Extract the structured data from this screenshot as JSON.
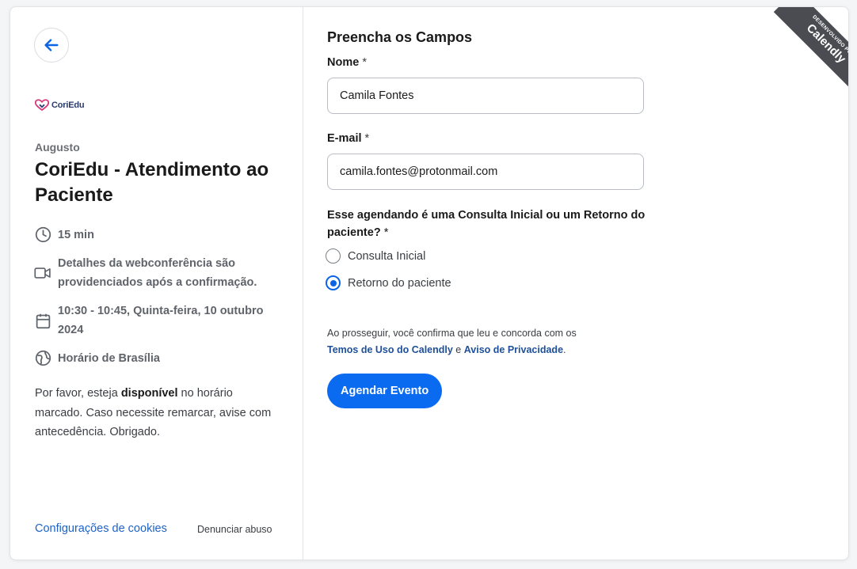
{
  "sidebar": {
    "back_label": "Voltar",
    "logo_text": "CoriEdu",
    "host_name": "Augusto",
    "event_title": "CoriEdu - Atendimento ao Paciente",
    "duration": "15 min",
    "conference_info": "Detalhes da webconferência são providenciados após a confirmação.",
    "datetime": "10:30 - 10:45, Quinta-feira, 10 outubro 2024",
    "timezone": "Horário de Brasília",
    "note_before": "Por favor, esteja ",
    "note_bold": "disponível",
    "note_after": " no horário marcado. Caso necessite remarcar, avise com antecedência. Obrigado.",
    "cookie_settings": "Configurações de cookies",
    "report_abuse": "Denunciar abuso"
  },
  "form": {
    "heading": "Preencha os Campos",
    "name_label": "Nome",
    "name_value": "Camila Fontes",
    "email_label": "E-mail",
    "email_value": "camila.fontes@protonmail.com",
    "required_mark": "*",
    "question": "Esse agendando é uma Consulta Inicial ou um Retorno do paciente?",
    "options": [
      {
        "label": "Consulta Inicial",
        "selected": false
      },
      {
        "label": "Retorno do paciente",
        "selected": true
      }
    ],
    "consent_text": "Ao prosseguir, você confirma que leu e concorda com os",
    "terms_link": "Temos de Uso do Calendly",
    "consent_and": " e ",
    "privacy_link": "Aviso de Privacidade",
    "consent_end": ".",
    "submit_label": "Agendar Evento"
  },
  "badge": {
    "line1": "DESENVOLVIDO POR",
    "line2": "Calendly"
  },
  "colors": {
    "accent": "#0b6bf0",
    "link": "#1d62c8",
    "brand_logo": "#d63a7a",
    "ribbon": "#4a4c52"
  }
}
